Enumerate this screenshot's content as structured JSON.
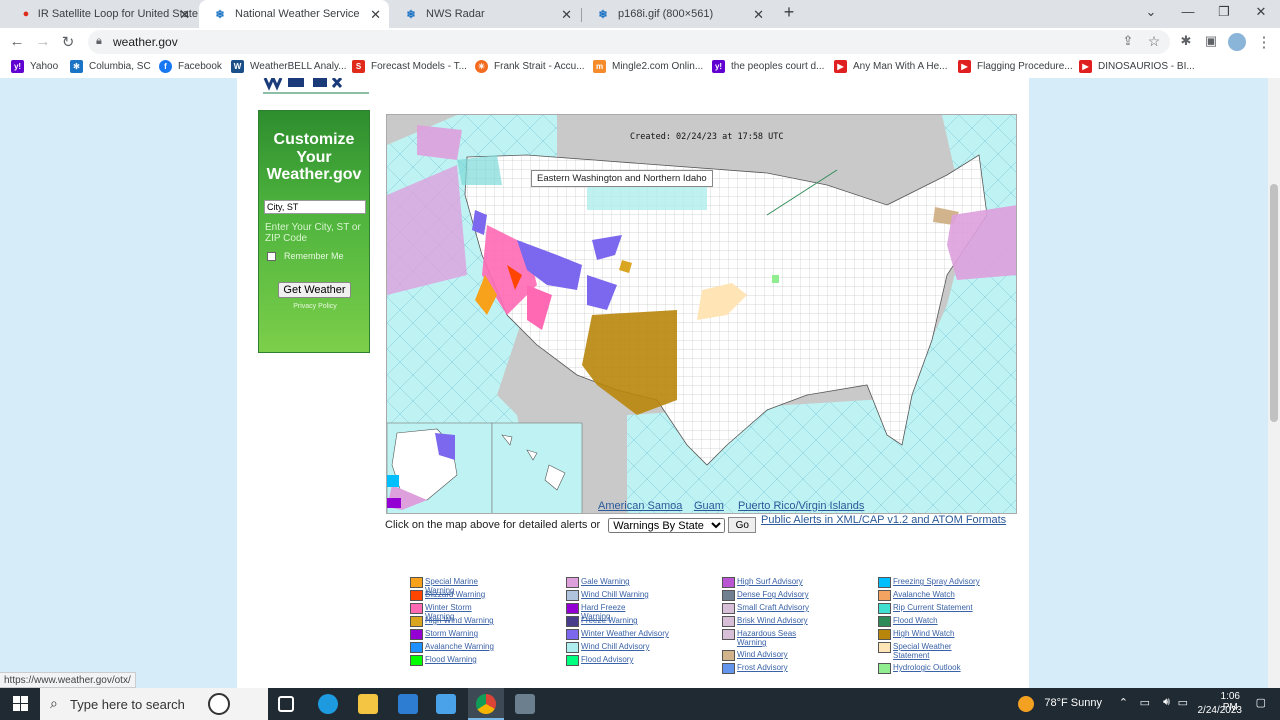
{
  "browser": {
    "tabs": [
      {
        "title": "IR Satellite Loop for United State",
        "icon": "accuweather-icon",
        "active": false
      },
      {
        "title": "National Weather Service",
        "icon": "nws-icon",
        "active": true
      },
      {
        "title": "NWS Radar",
        "icon": "nws-icon",
        "active": false
      },
      {
        "title": "p168i.gif (800×561)",
        "icon": "nws-icon",
        "active": false
      }
    ],
    "new_tab": "+",
    "url": "weather.gov",
    "bookmarks": [
      {
        "label": "Yahoo",
        "color": "#6001d2"
      },
      {
        "label": "Columbia, SC",
        "color": "#1a73c4"
      },
      {
        "label": "Facebook",
        "color": "#1877f2"
      },
      {
        "label": "WeatherBELL Analy...",
        "color": "#1b4f8a"
      },
      {
        "label": "Forecast Models - T...",
        "color": "#e02a1b"
      },
      {
        "label": "Frank Strait - Accu...",
        "color": "#f26b1f"
      },
      {
        "label": "Mingle2.com Onlin...",
        "color": "#f58b2a"
      },
      {
        "label": "the peoples court d...",
        "color": "#6001d2"
      },
      {
        "label": "Any Man With A He...",
        "color": "#e02020"
      },
      {
        "label": "Flagging Procedure...",
        "color": "#e02020"
      },
      {
        "label": "DINOSAURIOS - BI...",
        "color": "#e02020"
      }
    ]
  },
  "customize": {
    "title": "Customize Your Weather.gov",
    "input_value": "City, ST",
    "hint": "Enter Your City, ST or ZIP Code",
    "remember": "Remember Me",
    "button": "Get Weather",
    "privacy": "Privacy Policy"
  },
  "map": {
    "created": "Created: 02/24/23 at 17:58 UTC",
    "tooltip": "Eastern Washington and Northern Idaho",
    "territories": [
      "American Samoa",
      "Guam",
      "Puerto Rico/Virgin Islands"
    ],
    "note": "Click on the map above for detailed alerts or",
    "select_value": "Warnings By State",
    "go": "Go",
    "xml_link": "Public Alerts in XML/CAP v1.2 and ATOM Formats"
  },
  "legend": [
    [
      {
        "label": "Special Marine Warning",
        "color": "#f7a21a"
      },
      {
        "label": "Blizzard Warning",
        "color": "#ff4500"
      },
      {
        "label": "Winter Storm Warning",
        "color": "#ff69b4"
      },
      {
        "label": "High Wind Warning",
        "color": "#daa520"
      },
      {
        "label": "Storm Warning",
        "color": "#9400d3"
      },
      {
        "label": "Avalanche Warning",
        "color": "#1e90ff"
      },
      {
        "label": "Flood Warning",
        "color": "#00ff00"
      }
    ],
    [
      {
        "label": "Gale Warning",
        "color": "#dda0dd"
      },
      {
        "label": "Wind Chill Warning",
        "color": "#b0c4de"
      },
      {
        "label": "Hard Freeze Warning",
        "color": "#9400d3"
      },
      {
        "label": "Freeze Warning",
        "color": "#483d8b"
      },
      {
        "label": "Winter Weather Advisory",
        "color": "#7b68ee"
      },
      {
        "label": "Wind Chill Advisory",
        "color": "#afeeee"
      },
      {
        "label": "Flood Advisory",
        "color": "#00ff7f"
      }
    ],
    [
      {
        "label": "High Surf Advisory",
        "color": "#ba55d3"
      },
      {
        "label": "Dense Fog Advisory",
        "color": "#708090"
      },
      {
        "label": "Small Craft Advisory",
        "color": "#d8bfd8"
      },
      {
        "label": "Brisk Wind Advisory",
        "color": "#d8bfd8"
      },
      {
        "label": "Hazardous Seas Warning",
        "color": "#d8bfd8"
      },
      {
        "label": "Wind Advisory",
        "color": "#d2b48c"
      },
      {
        "label": "Frost Advisory",
        "color": "#6495ed"
      }
    ],
    [
      {
        "label": "Freezing Spray Advisory",
        "color": "#00bfff"
      },
      {
        "label": "Avalanche Watch",
        "color": "#f4a460"
      },
      {
        "label": "Rip Current Statement",
        "color": "#40e0d0"
      },
      {
        "label": "Flood Watch",
        "color": "#2e8b57"
      },
      {
        "label": "High Wind Watch",
        "color": "#b8860b"
      },
      {
        "label": "Special Weather Statement",
        "color": "#ffe4b5"
      },
      {
        "label": "Hydrologic Outlook",
        "color": "#90ee90"
      }
    ]
  ],
  "status_url": "https://www.weather.gov/otx/",
  "taskbar": {
    "search": "Type here to search",
    "weather": "78°F  Sunny",
    "time": "1:06 PM",
    "date": "2/24/2023"
  }
}
